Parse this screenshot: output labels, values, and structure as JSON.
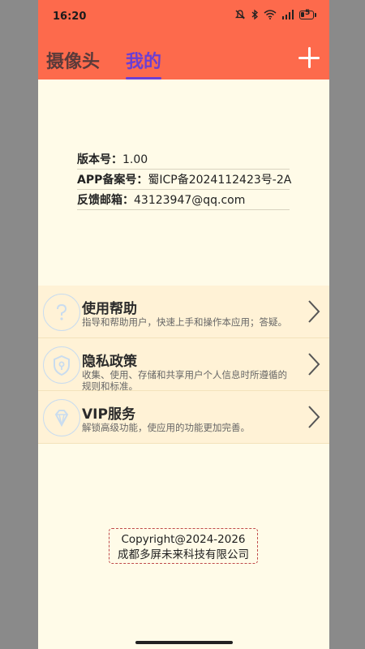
{
  "status_bar": {
    "time": "16:20",
    "battery": "5"
  },
  "header": {
    "tabs": [
      {
        "label": "摄像头",
        "active": false
      },
      {
        "label": "我的",
        "active": true
      }
    ],
    "add_icon": "plus-icon",
    "colors": {
      "bar": "#fd6a4c",
      "active_tab": "#6b3fd3"
    }
  },
  "info": {
    "version_label": "版本号：",
    "version_value": "1.00",
    "icp_label": "APP备案号：",
    "icp_value": "蜀ICP备2024112423号-2A",
    "email_label": "反馈邮箱：",
    "email_value": "43123947@qq.com"
  },
  "menu": [
    {
      "title": "使用帮助",
      "desc": "指导和帮助用户，快速上手和操作本应用；答疑。",
      "icon": "question-icon"
    },
    {
      "title": "隐私政策",
      "desc": "收集、使用、存储和共享用户个人信息时所遵循的规则和标准。",
      "icon": "shield-icon"
    },
    {
      "title": "VIP服务",
      "desc": "解锁高级功能，使应用的功能更加完善。",
      "icon": "diamond-icon"
    }
  ],
  "footer": {
    "line1": "Copyright@2024-2026",
    "line2": "成都多屏未来科技有限公司"
  }
}
